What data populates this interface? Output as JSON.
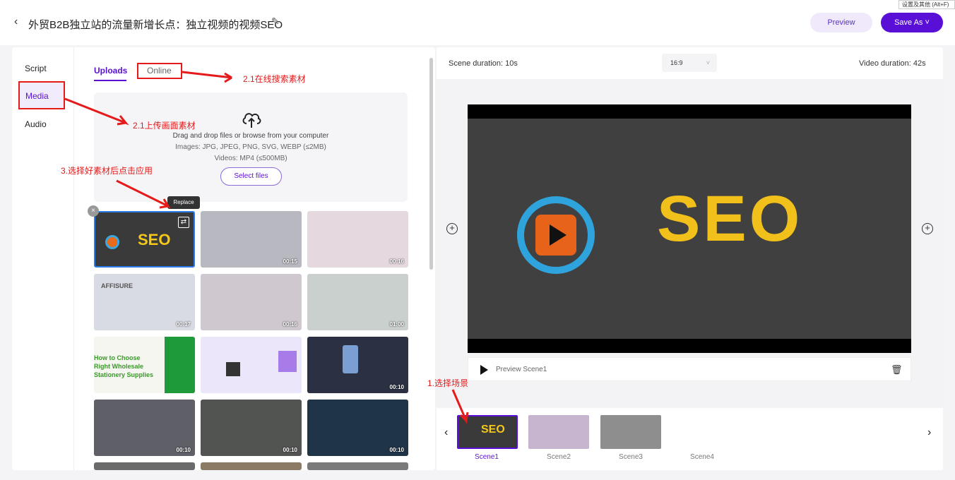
{
  "header": {
    "back_icon": "chevron-left-icon",
    "title": "外贸B2B独立站的流量新增长点：独立视频的视频SEO",
    "preview_label": "Preview",
    "save_label": "Save As",
    "tooltip": "设置及其他 (Alt+F)"
  },
  "sidebar": {
    "items": [
      {
        "label": "Script"
      },
      {
        "label": "Media"
      },
      {
        "label": "Audio"
      }
    ]
  },
  "media": {
    "tabs": [
      {
        "label": "Uploads"
      },
      {
        "label": "Online"
      }
    ],
    "dropzone": {
      "line1": "Drag and drop files or browse from your computer",
      "line2": "Images: JPG, JPEG, PNG, SVG, WEBP (≤2MB)",
      "line3": "Videos: MP4 (≤500MB)",
      "button": "Select files"
    },
    "replace_tooltip": "Replace",
    "thumbs": [
      {
        "duration": "",
        "text": "SEO",
        "color": "#3a3a3a"
      },
      {
        "duration": "00:15",
        "color": "#b8b8c0"
      },
      {
        "duration": "00:16",
        "color": "#e6d8df"
      },
      {
        "duration": "00:17",
        "text": "AFFISURE",
        "color": "#d8dbe3"
      },
      {
        "duration": "00:16",
        "color": "#cfc9cf"
      },
      {
        "duration": "01:00",
        "color": "#c9d0cd"
      },
      {
        "duration": "",
        "text": "How to Choose Right Wholesale Stationery Supplies",
        "color": "#f4f6ef"
      },
      {
        "duration": "",
        "color": "#ece6fb"
      },
      {
        "duration": "00:10",
        "color": "#2b3142"
      },
      {
        "duration": "00:10",
        "color": "#5f6067"
      },
      {
        "duration": "00:10",
        "color": "#525452"
      },
      {
        "duration": "00:10",
        "color": "#203448"
      }
    ]
  },
  "editor": {
    "scene_duration": "Scene duration: 10s",
    "ratio": "16:9",
    "video_duration": "Video duration: 42s",
    "preview_scene": "Preview Scene1",
    "video_text": "SEO"
  },
  "scenes": [
    {
      "label": "Scene1",
      "color": "#3a3a3a",
      "text": "SEO"
    },
    {
      "label": "Scene2",
      "color": "#c7b4ce"
    },
    {
      "label": "Scene3",
      "color": "#8e8e8e"
    },
    {
      "label": "Scene4",
      "color": "#ffffff"
    }
  ],
  "annotations": {
    "online": "2.1在线搜索素材",
    "upload": "2.1上传画面素材",
    "apply": "3.选择好素材后点击应用",
    "scene": "1.选择场景"
  }
}
